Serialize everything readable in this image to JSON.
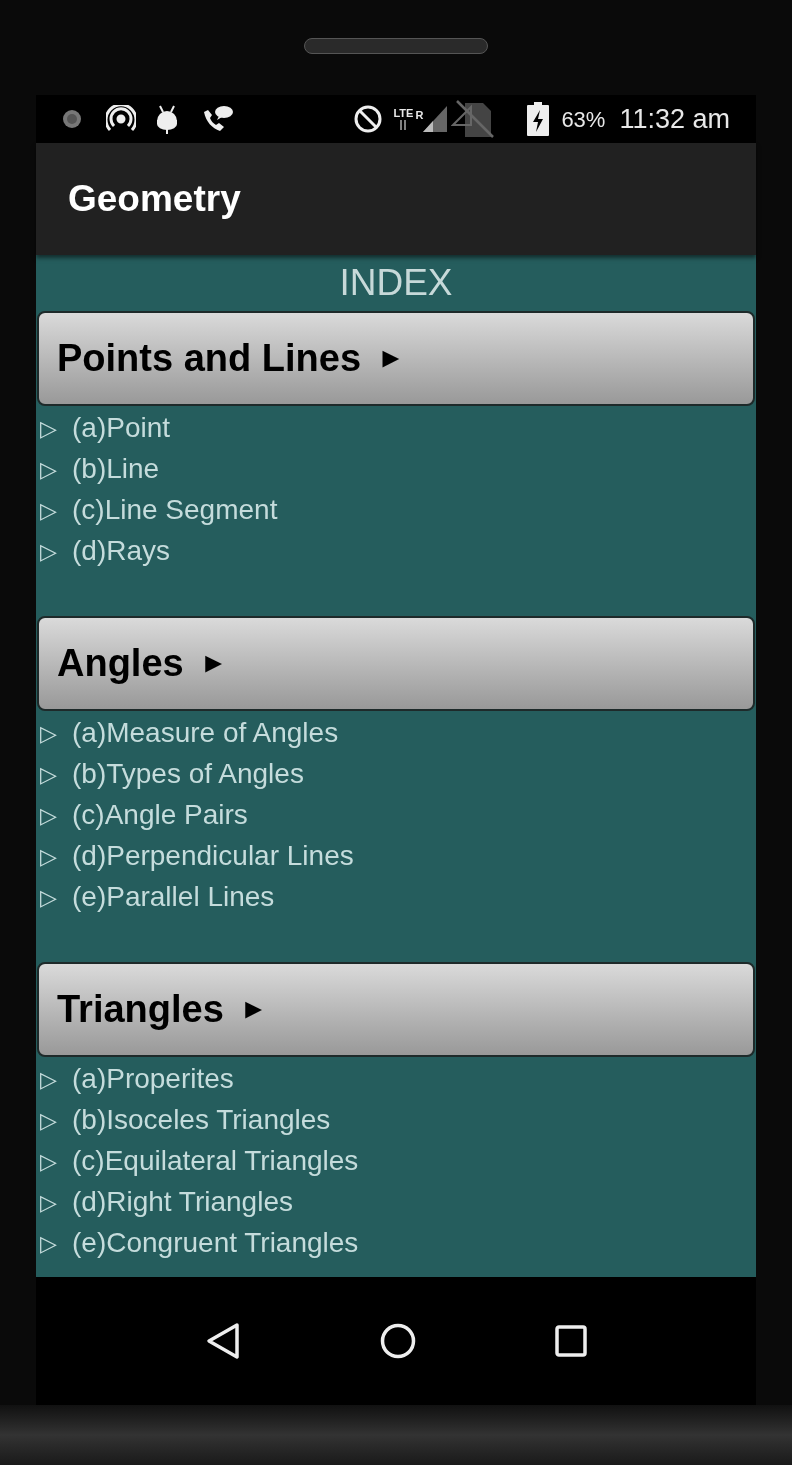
{
  "status_bar": {
    "network": "LTE",
    "roaming": "R",
    "battery": "63%",
    "time": "11:32 am"
  },
  "app_bar": {
    "title": "Geometry"
  },
  "index_title": "INDEX",
  "sections": [
    {
      "title": "Points and Lines",
      "arrow": "►",
      "items": [
        {
          "bullet": "▷",
          "label": "(a)Point"
        },
        {
          "bullet": "▷",
          "label": "(b)Line"
        },
        {
          "bullet": "▷",
          "label": "(c)Line Segment"
        },
        {
          "bullet": "▷",
          "label": "(d)Rays"
        }
      ]
    },
    {
      "title": "Angles",
      "arrow": "►",
      "items": [
        {
          "bullet": "▷",
          "label": "(a)Measure of Angles"
        },
        {
          "bullet": "▷",
          "label": "(b)Types of Angles"
        },
        {
          "bullet": "▷",
          "label": "(c)Angle Pairs"
        },
        {
          "bullet": "▷",
          "label": "(d)Perpendicular Lines"
        },
        {
          "bullet": "▷",
          "label": "(e)Parallel Lines"
        }
      ]
    },
    {
      "title": "Triangles",
      "arrow": "►",
      "items": [
        {
          "bullet": "▷",
          "label": "(a)Properites"
        },
        {
          "bullet": "▷",
          "label": "(b)Isoceles Triangles"
        },
        {
          "bullet": "▷",
          "label": "(c)Equilateral Triangles"
        },
        {
          "bullet": "▷",
          "label": "(d)Right Triangles"
        },
        {
          "bullet": "▷",
          "label": "(e)Congruent Triangles"
        }
      ]
    }
  ]
}
